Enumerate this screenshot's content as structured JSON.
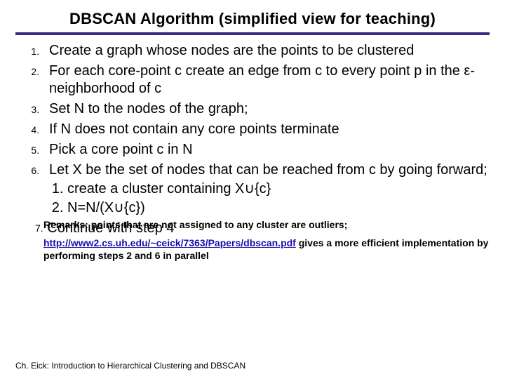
{
  "title": "DBSCAN Algorithm (simplified view for teaching)",
  "steps": {
    "s1": "Create a graph whose nodes are the points to be clustered",
    "s2": "For each core-point c create an edge from c to every point p in the ε-neighborhood of c",
    "s3": "Set N to the nodes of the graph;",
    "s4": "If N does not contain any core points terminate",
    "s5": "Pick a core point c in N",
    "s6": "Let X be the set of nodes that can be reached from c by going forward;",
    "s6a": "create a cluster containing X∪{c}",
    "s6b": "N=N/(X∪{c})",
    "s7_num": "7.",
    "s7_text": "Continue with step 4"
  },
  "remarks": {
    "line1": "Remarks: points that are not assigned to any cluster are outliers;",
    "link_text": "http://www2.cs.uh.edu/~ceick/7363/Papers/dbscan.pdf",
    "link_tail": " gives a more efficient implementation by",
    "line3": "performing steps 2 and 6 in parallel"
  },
  "footer": "Ch. Eick: Introduction to Hierarchical Clustering and DBSCAN"
}
